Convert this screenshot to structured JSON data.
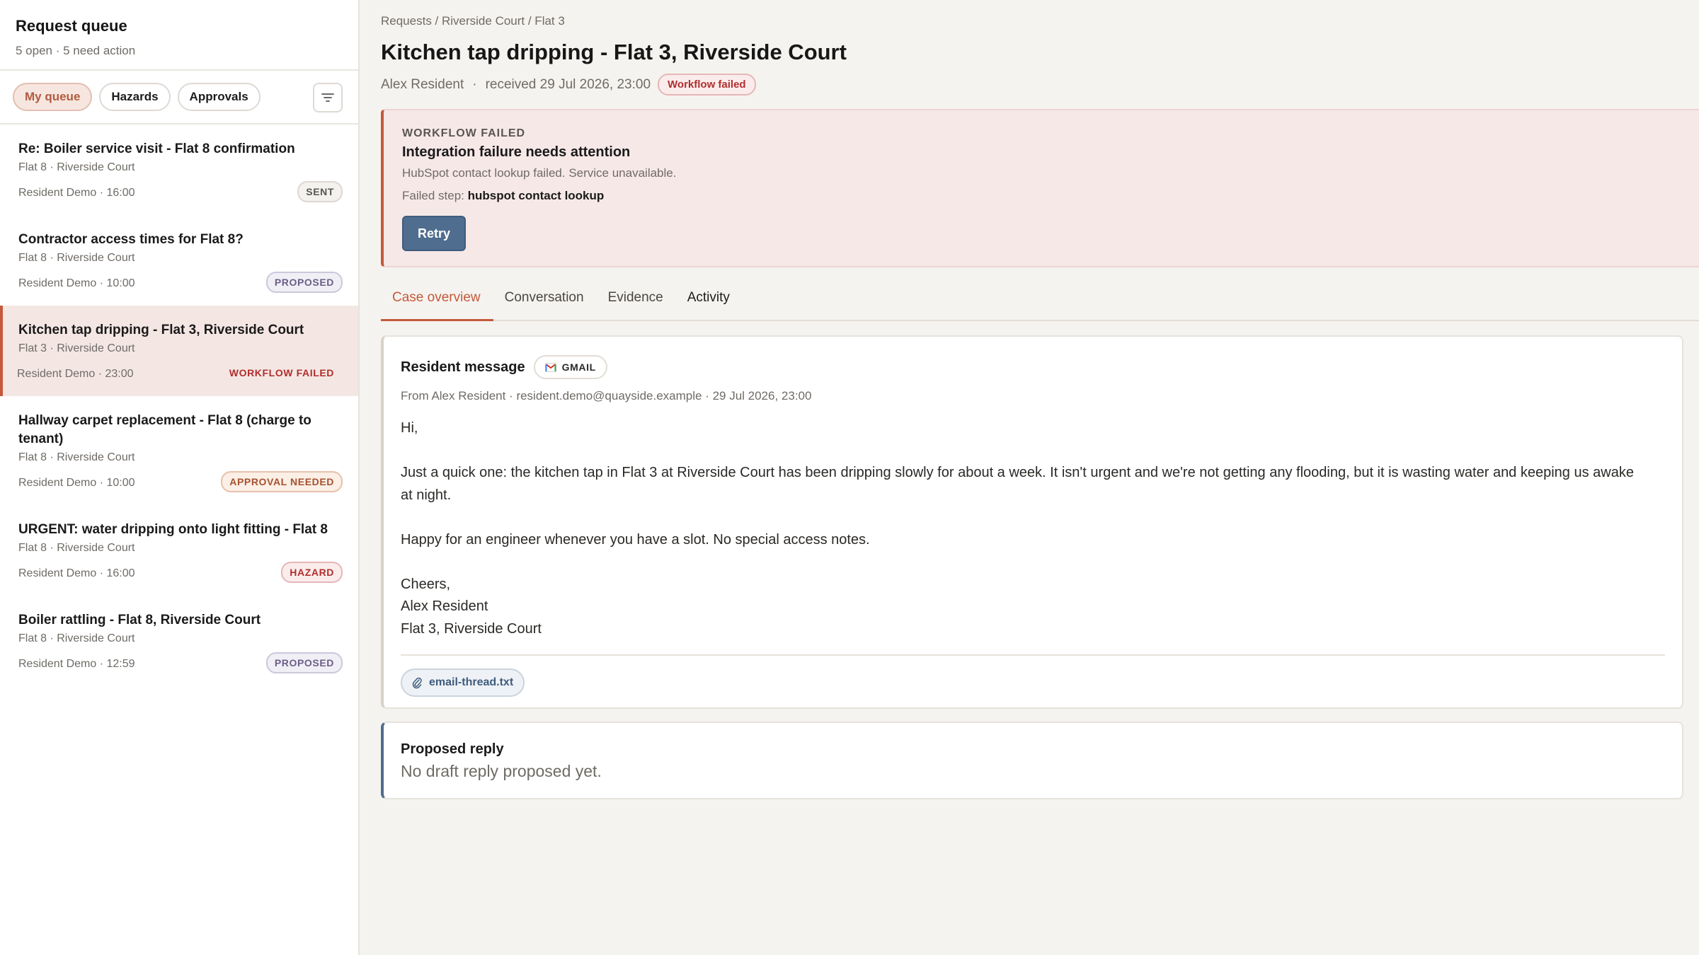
{
  "sidebar": {
    "title": "Request queue",
    "subtitle": "5 open · 5 need action",
    "filters": [
      {
        "label": "My queue",
        "active": true
      },
      {
        "label": "Hazards",
        "active": false
      },
      {
        "label": "Approvals",
        "active": false
      }
    ],
    "items": [
      {
        "title": "Re: Boiler service visit - Flat 8 confirmation",
        "location": "Flat 8 · Riverside Court",
        "meta": "Resident Demo · 16:00",
        "badge": "SENT"
      },
      {
        "title": "Contractor access times for Flat 8?",
        "location": "Flat 8 · Riverside Court",
        "meta": "Resident Demo · 10:00",
        "badge": "PROPOSED"
      },
      {
        "title": "Kitchen tap dripping - Flat 3, Riverside Court",
        "location": "Flat 3 · Riverside Court",
        "meta": "Resident Demo · 23:00",
        "badge": "WORKFLOW FAILED"
      },
      {
        "title": "Hallway carpet replacement - Flat 8 (charge to tenant)",
        "location": "Flat 8 · Riverside Court",
        "meta": "Resident Demo · 10:00",
        "badge": "APPROVAL NEEDED"
      },
      {
        "title": "URGENT: water dripping onto light fitting - Flat 8",
        "location": "Flat 8 · Riverside Court",
        "meta": "Resident Demo · 16:00",
        "badge": "HAZARD"
      },
      {
        "title": "Boiler rattling - Flat 8, Riverside Court",
        "location": "Flat 8 · Riverside Court",
        "meta": "Resident Demo · 12:59",
        "badge": "PROPOSED"
      }
    ]
  },
  "main": {
    "breadcrumb": "Requests / Riverside Court / Flat 3",
    "title": "Kitchen tap dripping - Flat 3, Riverside Court",
    "resident": "Alex Resident",
    "received": "received 29 Jul 2026, 23:00",
    "status": "Workflow failed",
    "alert": {
      "kicker": "WORKFLOW FAILED",
      "title": "Integration failure needs attention",
      "description": "HubSpot contact lookup failed. Service unavailable.",
      "step_label": "Failed step:",
      "step_value": "hubspot contact lookup",
      "retry_label": "Retry"
    },
    "tabs": [
      {
        "label": "Case overview",
        "active": true
      },
      {
        "label": "Conversation",
        "active": false
      },
      {
        "label": "Evidence",
        "active": false
      },
      {
        "label": "Activity",
        "active": false
      }
    ],
    "message": {
      "label": "Resident message",
      "source": "GMAIL",
      "from": "From Alex Resident · resident.demo@quayside.example · 29 Jul 2026, 23:00",
      "body": "Hi,\n\nJust a quick one: the kitchen tap in Flat 3 at Riverside Court has been dripping slowly for about a week. It isn't urgent and we're not getting any flooding, but it is wasting water and keeping us awake at night.\n\nHappy for an engineer whenever you have a slot. No special access notes.\n\nCheers,\nAlex Resident\nFlat 3, Riverside Court",
      "attachment": "email-thread.txt"
    },
    "reply": {
      "title": "Proposed reply",
      "text": "No draft reply proposed yet."
    }
  },
  "colors": {
    "accent": "#c4593b",
    "primary_button": "#4f6d8f",
    "danger": "#b12e2e"
  }
}
